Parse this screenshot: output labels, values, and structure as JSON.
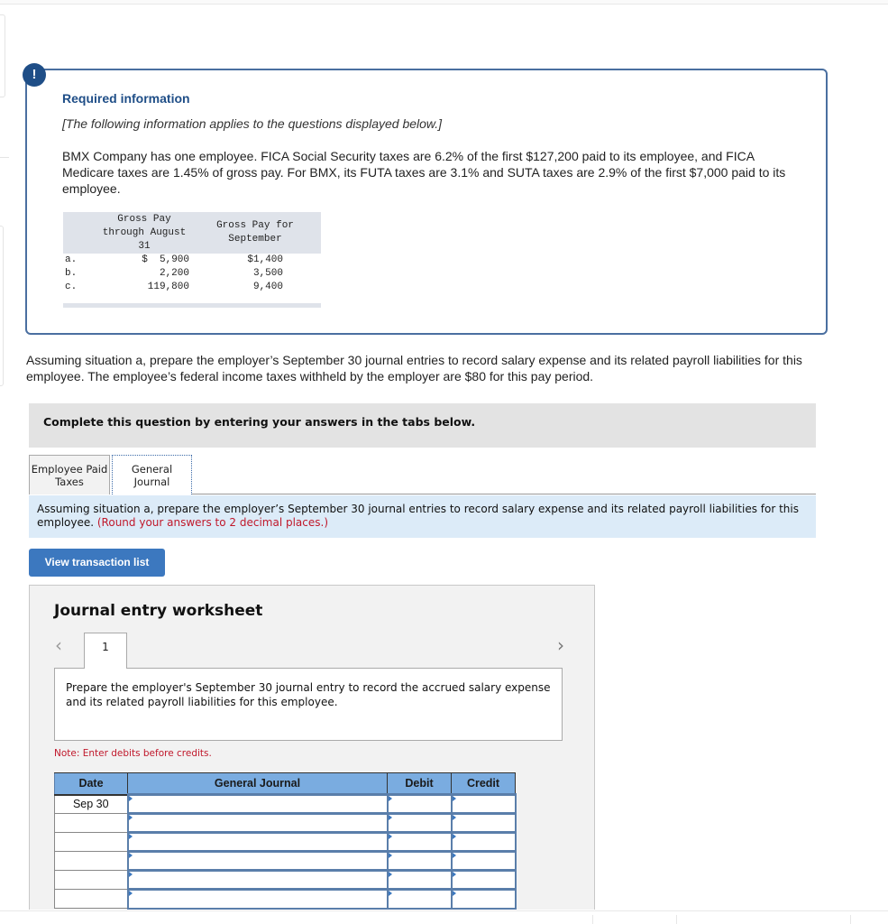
{
  "info": {
    "badge": "!",
    "title": "Required information",
    "subtitle": "[The following information applies to the questions displayed below.]",
    "body": "BMX Company has one employee. FICA Social Security taxes are 6.2% of the first $127,200 paid to its employee, and FICA Medicare taxes are 1.45% of gross pay. For BMX, its FUTA taxes are 3.1% and SUTA taxes are 2.9% of the first $7,000 paid to its employee.",
    "table": {
      "headers": [
        "",
        "Gross Pay through August 31",
        "Gross Pay for September"
      ],
      "rows": [
        {
          "label": "a.",
          "through_aug": "$  5,900",
          "september": "$1,400"
        },
        {
          "label": "b.",
          "through_aug": "2,200",
          "september": "3,500"
        },
        {
          "label": "c.",
          "through_aug": "119,800",
          "september": "9,400"
        }
      ]
    }
  },
  "question": "Assuming situation a, prepare the employer’s September 30 journal entries to record salary expense and its related payroll liabilities for this employee. The employee’s federal income taxes withheld by the employer are $80 for this pay period.",
  "complete_banner": "Complete this question by entering your answers in the tabs below.",
  "tabs": [
    {
      "label_line1": "Employee Paid",
      "label_line2": "Taxes",
      "active": false
    },
    {
      "label_line1": "General",
      "label_line2": "Journal",
      "active": true
    }
  ],
  "instructions": {
    "text": "Assuming situation a, prepare the employer’s September 30 journal entries to record salary expense and its related payroll liabilities for this employee.",
    "note": "(Round your answers to 2 decimal places.)"
  },
  "view_transaction_button": "View transaction list",
  "worksheet": {
    "title": "Journal entry worksheet",
    "prev_icon": "chevron-left-icon",
    "next_icon": "chevron-right-icon",
    "current_tab": "1",
    "prompt": "Prepare the employer's September 30 journal entry to record the accrued salary expense and its related payroll liabilities for this employee.",
    "note": "Note: Enter debits before credits.",
    "columns": [
      "Date",
      "General Journal",
      "Debit",
      "Credit"
    ],
    "rows": [
      {
        "date": "Sep 30",
        "account": "",
        "debit": "",
        "credit": ""
      },
      {
        "date": "",
        "account": "",
        "debit": "",
        "credit": ""
      },
      {
        "date": "",
        "account": "",
        "debit": "",
        "credit": ""
      },
      {
        "date": "",
        "account": "",
        "debit": "",
        "credit": ""
      },
      {
        "date": "",
        "account": "",
        "debit": "",
        "credit": ""
      },
      {
        "date": "",
        "account": "",
        "debit": "",
        "credit": ""
      }
    ]
  },
  "colors": {
    "brand_blue": "#1f4e87",
    "button_blue": "#3c78bf",
    "header_blue": "#7aace0",
    "instruction_bg": "#dcebf8",
    "error_red": "#c0182b"
  }
}
